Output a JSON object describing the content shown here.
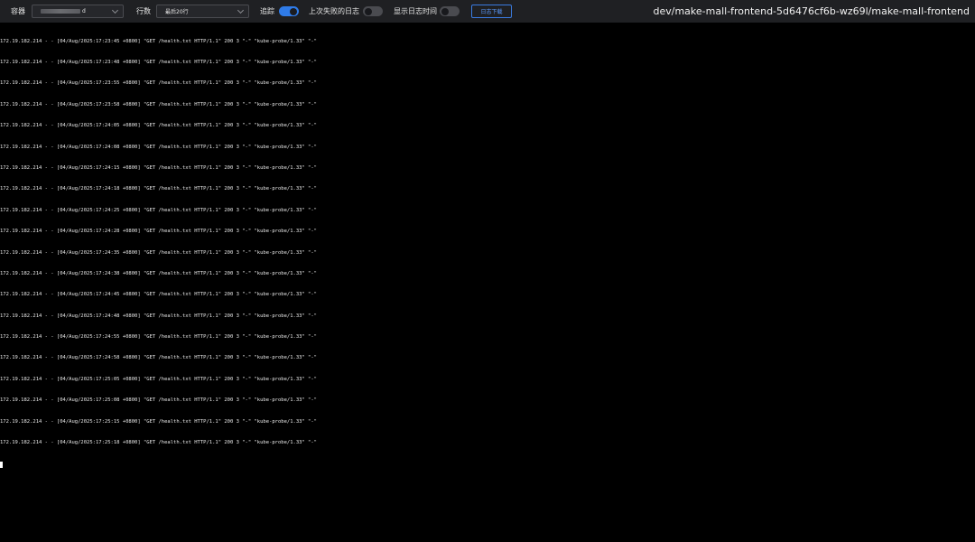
{
  "toolbar": {
    "container_label": "容器",
    "container_value_suffix": "d",
    "lines_label": "行数",
    "lines_value": "最后20行",
    "follow_label": "追踪",
    "follow_on": true,
    "previous_label": "上次失败的日志",
    "previous_on": false,
    "timestamps_label": "显示日志时间",
    "timestamps_on": false,
    "download_label": "日志下载"
  },
  "pod_title": "dev/make-mall-frontend-5d6476cf6b-wz69l/make-mall-frontend",
  "log_lines": [
    "172.19.182.214 - - [04/Aug/2025:17:23:45 +0800] \"GET /health.txt HTTP/1.1\" 200 3 \"-\" \"kube-probe/1.33\" \"-\"",
    "172.19.182.214 - - [04/Aug/2025:17:23:48 +0800] \"GET /health.txt HTTP/1.1\" 200 3 \"-\" \"kube-probe/1.33\" \"-\"",
    "172.19.182.214 - - [04/Aug/2025:17:23:55 +0800] \"GET /health.txt HTTP/1.1\" 200 3 \"-\" \"kube-probe/1.33\" \"-\"",
    "172.19.182.214 - - [04/Aug/2025:17:23:58 +0800] \"GET /health.txt HTTP/1.1\" 200 3 \"-\" \"kube-probe/1.33\" \"-\"",
    "172.19.182.214 - - [04/Aug/2025:17:24:05 +0800] \"GET /health.txt HTTP/1.1\" 200 3 \"-\" \"kube-probe/1.33\" \"-\"",
    "172.19.182.214 - - [04/Aug/2025:17:24:08 +0800] \"GET /health.txt HTTP/1.1\" 200 3 \"-\" \"kube-probe/1.33\" \"-\"",
    "172.19.182.214 - - [04/Aug/2025:17:24:15 +0800] \"GET /health.txt HTTP/1.1\" 200 3 \"-\" \"kube-probe/1.33\" \"-\"",
    "172.19.182.214 - - [04/Aug/2025:17:24:18 +0800] \"GET /health.txt HTTP/1.1\" 200 3 \"-\" \"kube-probe/1.33\" \"-\"",
    "172.19.182.214 - - [04/Aug/2025:17:24:25 +0800] \"GET /health.txt HTTP/1.1\" 200 3 \"-\" \"kube-probe/1.33\" \"-\"",
    "172.19.182.214 - - [04/Aug/2025:17:24:28 +0800] \"GET /health.txt HTTP/1.1\" 200 3 \"-\" \"kube-probe/1.33\" \"-\"",
    "172.19.182.214 - - [04/Aug/2025:17:24:35 +0800] \"GET /health.txt HTTP/1.1\" 200 3 \"-\" \"kube-probe/1.33\" \"-\"",
    "172.19.182.214 - - [04/Aug/2025:17:24:38 +0800] \"GET /health.txt HTTP/1.1\" 200 3 \"-\" \"kube-probe/1.33\" \"-\"",
    "172.19.182.214 - - [04/Aug/2025:17:24:45 +0800] \"GET /health.txt HTTP/1.1\" 200 3 \"-\" \"kube-probe/1.33\" \"-\"",
    "172.19.182.214 - - [04/Aug/2025:17:24:48 +0800] \"GET /health.txt HTTP/1.1\" 200 3 \"-\" \"kube-probe/1.33\" \"-\"",
    "172.19.182.214 - - [04/Aug/2025:17:24:55 +0800] \"GET /health.txt HTTP/1.1\" 200 3 \"-\" \"kube-probe/1.33\" \"-\"",
    "172.19.182.214 - - [04/Aug/2025:17:24:58 +0800] \"GET /health.txt HTTP/1.1\" 200 3 \"-\" \"kube-probe/1.33\" \"-\"",
    "172.19.182.214 - - [04/Aug/2025:17:25:05 +0800] \"GET /health.txt HTTP/1.1\" 200 3 \"-\" \"kube-probe/1.33\" \"-\"",
    "172.19.182.214 - - [04/Aug/2025:17:25:08 +0800] \"GET /health.txt HTTP/1.1\" 200 3 \"-\" \"kube-probe/1.33\" \"-\"",
    "172.19.182.214 - - [04/Aug/2025:17:25:15 +0800] \"GET /health.txt HTTP/1.1\" 200 3 \"-\" \"kube-probe/1.33\" \"-\"",
    "172.19.182.214 - - [04/Aug/2025:17:25:18 +0800] \"GET /health.txt HTTP/1.1\" 200 3 \"-\" \"kube-probe/1.33\" \"-\""
  ],
  "colors": {
    "toolbar_bg": "#1f2023",
    "terminal_bg": "#000000",
    "accent": "#2f7be8"
  }
}
